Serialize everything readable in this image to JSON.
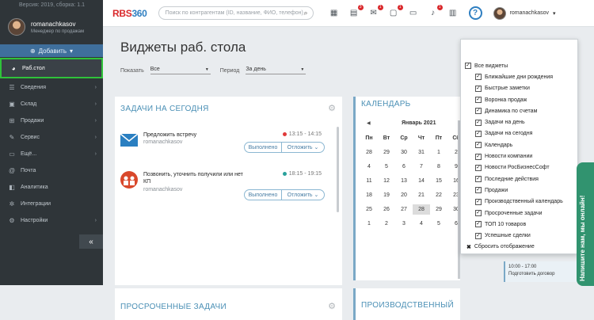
{
  "sidebar": {
    "version": "Версия: 2019, сборка: 1.1",
    "user_name": "romanachkasov",
    "user_role": "Менеджер по продажам",
    "add_label": "Добавить",
    "items": [
      {
        "label": "Раб.стол",
        "icon": "pie-chart-icon"
      },
      {
        "label": "Сведения",
        "icon": "list-icon"
      },
      {
        "label": "Склад",
        "icon": "box-icon"
      },
      {
        "label": "Продажи",
        "icon": "cart-icon"
      },
      {
        "label": "Сервис",
        "icon": "wrench-icon"
      },
      {
        "label": "Ещё...",
        "icon": "folder-icon"
      },
      {
        "label": "Почта",
        "icon": "at-icon"
      },
      {
        "label": "Аналитика",
        "icon": "chart-icon"
      },
      {
        "label": "Интеграции",
        "icon": "gear-icon"
      },
      {
        "label": "Настройки",
        "icon": "settings-icon"
      }
    ]
  },
  "topbar": {
    "logo_a": "RBS",
    "logo_b": "360",
    "search_placeholder": "Поиск по контрагентам (ID, название, ФИО, телефон)",
    "badges": {
      "tasks": "3",
      "mail": "1",
      "chat": "1",
      "bell": "1"
    },
    "user_name": "romanachkasov"
  },
  "page": {
    "title": "Виджеты раб. стола",
    "show_label": "Показать",
    "show_value": "Все",
    "period_label": "Период",
    "period_value": "За день"
  },
  "tasks_widget": {
    "title": "ЗАДАЧИ НА СЕГОДНЯ",
    "tasks": [
      {
        "title": "Предложить встречу",
        "author": "romanachkasov",
        "time": "13:15 - 14:15",
        "status_color": "#e03a3a",
        "done_label": "Выполнено",
        "postpone_label": "Отложить"
      },
      {
        "title": "Позвонить, уточнить получили или нет КП",
        "author": "romanachkasov",
        "time": "18:15 - 19:15",
        "status_color": "#2aa19b",
        "done_label": "Выполнено",
        "postpone_label": "Отложить"
      }
    ]
  },
  "calendar_widget": {
    "title": "КАЛЕНДАРЬ",
    "month": "Январь 2021",
    "weekdays": [
      "Пн",
      "Вт",
      "Ср",
      "Чт",
      "Пт",
      "Сб"
    ],
    "weeks": [
      [
        "28",
        "29",
        "30",
        "31",
        "1",
        "2"
      ],
      [
        "4",
        "5",
        "6",
        "7",
        "8",
        "9"
      ],
      [
        "11",
        "12",
        "13",
        "14",
        "15",
        "16"
      ],
      [
        "18",
        "19",
        "20",
        "21",
        "22",
        "23"
      ],
      [
        "25",
        "26",
        "27",
        "28",
        "29",
        "30"
      ],
      [
        "1",
        "2",
        "3",
        "4",
        "5",
        "6"
      ]
    ],
    "today": "28"
  },
  "overdue_widget": {
    "title": "ПРОСРОЧЕННЫЕ ЗАДАЧИ"
  },
  "production_widget": {
    "title": "ПРОИЗВОДСТВЕННЫЙ"
  },
  "widget_menu": {
    "all_label": "Все виджеты",
    "items": [
      "Ближайшие дни рождения",
      "Быстрые заметки",
      "Воронка продаж",
      "Динамика по счетам",
      "Задачи на день",
      "Задачи на сегодня",
      "Календарь",
      "Новости компании",
      "Новости РосБизнесСофт",
      "Последние действия",
      "Продажи",
      "Производственный календарь",
      "Просроченные задачи",
      "ТОП 10 товаров",
      "Успешные сделки"
    ],
    "reset_label": "Сбросить отображение"
  },
  "chat": {
    "label": "Напишите нам, мы онлайн!"
  },
  "event": {
    "line1": "10:00 - 17:00",
    "line2": "Подготовить договор"
  }
}
